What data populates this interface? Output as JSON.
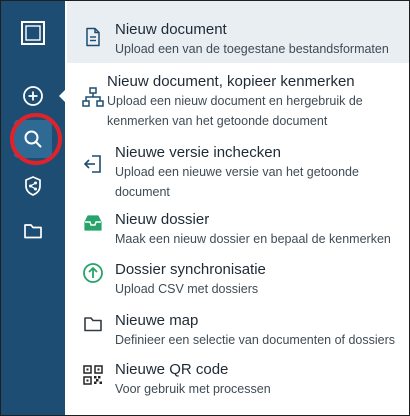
{
  "sidebar": {
    "icons": [
      "app-logo-icon",
      "add-circle-icon",
      "search-icon",
      "shield-share-icon",
      "folder-icon"
    ]
  },
  "menu": {
    "items": [
      {
        "title": "Nieuw document",
        "description": "Upload een van de toegestane bestandsformaten",
        "icon": "document-icon"
      },
      {
        "title": "Nieuw document, kopieer kenmerken",
        "description": "Upload een nieuw document en hergebruik de kenmerken van het getoonde document",
        "icon": "hierarchy-icon"
      },
      {
        "title": "Nieuwe versie inchecken",
        "description": "Upload een nieuwe versie van het getoonde document",
        "icon": "check-in-icon"
      },
      {
        "title": "Nieuw dossier",
        "description": "Maak een nieuw dossier en bepaal de kenmerken",
        "icon": "inbox-tray-icon"
      },
      {
        "title": "Dossier synchronisatie",
        "description": "Upload CSV met dossiers",
        "icon": "upload-circle-icon"
      },
      {
        "title": "Nieuwe map",
        "description": "Definieer een selectie van documenten of dossiers",
        "icon": "folder-icon"
      },
      {
        "title": "Nieuwe QR code",
        "description": "Voor gebruik met processen",
        "icon": "qr-code-icon"
      }
    ]
  },
  "colors": {
    "sidebar": "#1d4d72",
    "sidebar_active": "#2f6a94",
    "highlight_ring": "#e0232b",
    "item_icon_green": "#27a36b",
    "item_icon_blue": "#1d4d72",
    "active_item_bg": "#e9eef3"
  }
}
